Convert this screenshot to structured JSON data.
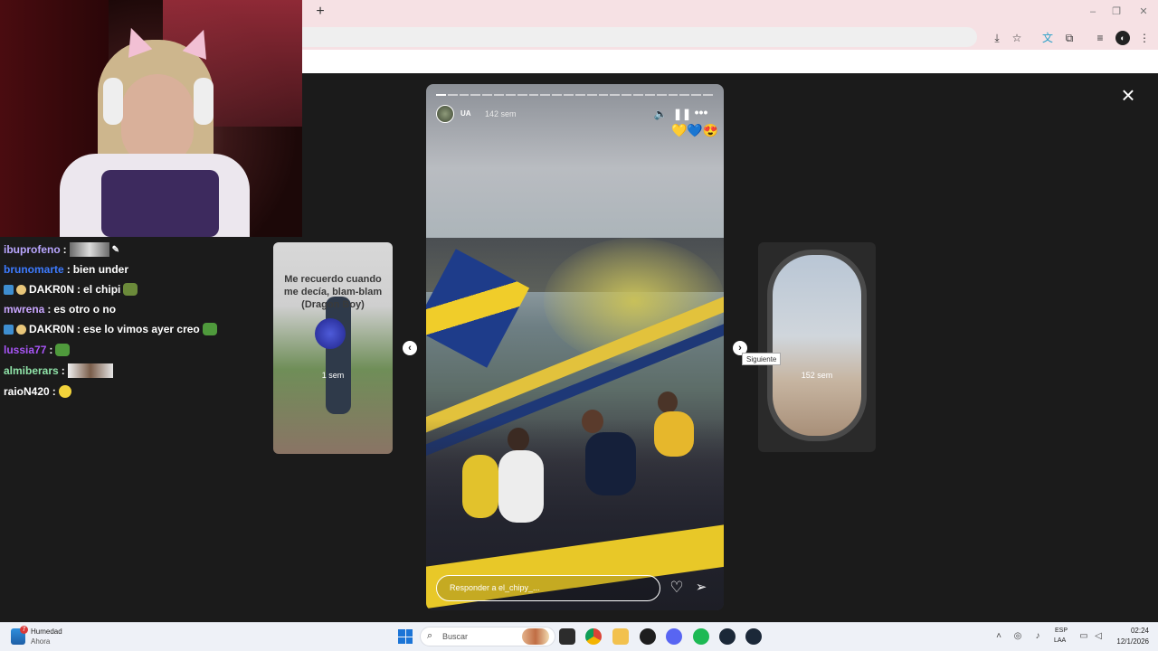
{
  "browser": {
    "new_tab": "+",
    "window_controls": [
      "–",
      "❐",
      "✕"
    ],
    "toolbar_icons": [
      "install-icon",
      "star-icon",
      "extension-icon",
      "puzzle-icon",
      "media-icon",
      "profile-icon",
      "menu-icon"
    ]
  },
  "chat": {
    "messages": [
      {
        "user": "ibuprofeno",
        "text": "",
        "user_color": "#b9a6ff",
        "emote": "image"
      },
      {
        "user": "brunomarte",
        "text": "bien under",
        "user_color": "#3d7bff"
      },
      {
        "user": "DAKR0N",
        "text": "el chipi",
        "user_color": "#ffffff",
        "badges": true,
        "emote": "frog"
      },
      {
        "user": "mwrena",
        "text": "es otro o no",
        "user_color": "#c9a6ff"
      },
      {
        "user": "DAKR0N",
        "text": "ese lo vimos ayer creo",
        "user_color": "#ffffff",
        "badges": true,
        "emote": "frog"
      },
      {
        "user": "lussia77",
        "text": "",
        "user_color": "#a855f7",
        "emote": "frog"
      },
      {
        "user": "almiberars",
        "text": "",
        "user_color": "#8fe3a8",
        "emote": "image"
      },
      {
        "user": "raioN420",
        "text": "",
        "user_color": "#ffffff",
        "emote": "smiley"
      }
    ],
    "separator": ":"
  },
  "stories": {
    "left_card": {
      "caption": "Me recuerdo cuando me decía, blam-blam (Dragon Boy)",
      "age": "1 sem"
    },
    "right_card": {
      "age": "152 sem"
    },
    "main": {
      "user": "UA",
      "time": "142 sem",
      "reactions": "💛💙😍",
      "reply_placeholder": "Responder a el_chipy_...",
      "segments": 24,
      "segments_done": 1
    },
    "next_tooltip": "Siguiente",
    "close_icon": "×"
  },
  "taskbar": {
    "weather_title": "Humedad",
    "weather_sub": "Ahora",
    "weather_badge": "7",
    "search_placeholder": "Buscar",
    "lang_1": "ESP",
    "lang_2": "LAA",
    "time": "02:24",
    "date": "12/1/2026",
    "apps": [
      "file-explorer-icon",
      "chrome-icon",
      "folder-icon",
      "app-icon",
      "discord-icon",
      "spotify-icon",
      "steam-icon",
      "steam-icon-2"
    ]
  }
}
